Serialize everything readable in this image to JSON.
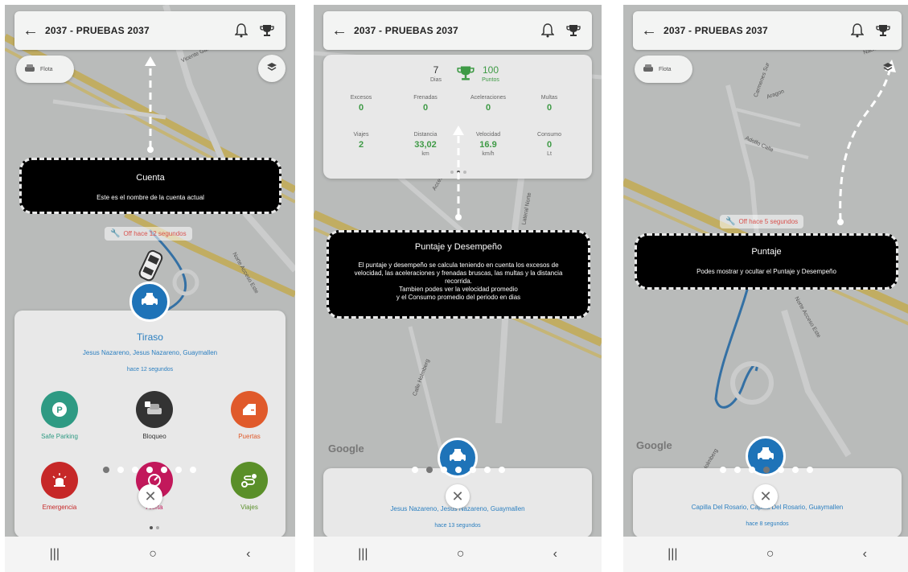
{
  "account_name": "2037 - PRUEBAS  2037",
  "fleet_label": "Flota",
  "google_label": "Google",
  "screen1": {
    "tour_title": "Cuenta",
    "tour_desc": "Este es el nombre de la cuenta actual",
    "status_text": "Off hace 12 segundos",
    "vehicle_name": "Tiraso",
    "address": "Jesus Nazareno, Jesus Nazareno, Guaymallen",
    "last_update": "hace 12 segundos",
    "actions": [
      {
        "label": "Safe Parking",
        "color": "#2e9a83"
      },
      {
        "label": "Bloqueo",
        "color": "#333333"
      },
      {
        "label": "Puertas",
        "color": "#e05a2b"
      },
      {
        "label": "Emergencia",
        "color": "#c62828"
      },
      {
        "label": "Alerta",
        "color": "#c2185b"
      },
      {
        "label": "Viajes",
        "color": "#5a8f29"
      }
    ],
    "road_labels": [
      "Vicente Gallo",
      "Norte Acceso Este"
    ]
  },
  "screen2": {
    "tour_title": "Puntaje y Desempeño",
    "tour_desc_lines": [
      "El puntaje y desempeño se calcula teniendo en cuenta los excesos de",
      "velocidad, las aceleraciones y frenadas bruscas, las multas y la distancia",
      "recorrida.",
      "Tambien podes ver la velocidad promedio",
      "y el Consumo promedio del periodo en dias"
    ],
    "days_value": "7",
    "days_label": "Dias",
    "points_value": "100",
    "points_label": "Puntos",
    "stats_row1": [
      {
        "label": "Excesos",
        "value": "0"
      },
      {
        "label": "Frenadas",
        "value": "0"
      },
      {
        "label": "Aceleraciones",
        "value": "0"
      },
      {
        "label": "Multas",
        "value": "0"
      }
    ],
    "stats_row2": [
      {
        "label": "Viajes",
        "value": "2",
        "unit": ""
      },
      {
        "label": "Distancia",
        "value": "33,02",
        "unit": "km"
      },
      {
        "label": "Velocidad",
        "value": "16.9",
        "unit": "km/h"
      },
      {
        "label": "Consumo",
        "value": "0",
        "unit": "Lt"
      }
    ],
    "address": "Jesus Nazareno, Jesus Nazareno, Guaymallen",
    "last_update": "hace 13 segundos",
    "road_labels": [
      "Calle Holmberg",
      "Lateral Norte",
      "Acceso Este"
    ]
  },
  "screen3": {
    "tour_title": "Puntaje",
    "tour_desc": "Podes mostrar y ocultar el Puntaje y Desempeño",
    "status_text": "Off hace 5 segundos",
    "address": "Capilla Del Rosario, Capilla Del Rosario, Guaymallen",
    "last_update": "hace 8 segundos",
    "road_labels": [
      "Carmenes Sur",
      "Aragon",
      "Adolfo Calle",
      "Norte Acceso Este",
      "Calle Holmberg",
      "Nacional"
    ]
  },
  "nav": {
    "recents": "|||",
    "home": "○",
    "back": "‹"
  }
}
